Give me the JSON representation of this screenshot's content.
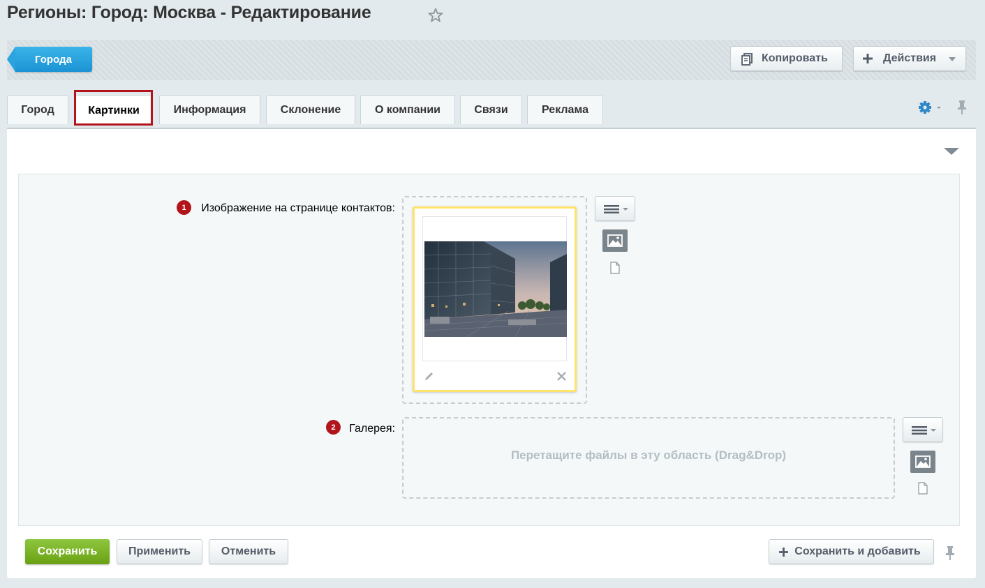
{
  "page": {
    "title": "Регионы: Город: Москва - Редактирование",
    "favorite_icon": "star-icon"
  },
  "toolbar": {
    "back_label": "Города",
    "copy_label": "Копировать",
    "actions_label": "Действия"
  },
  "tabs": [
    {
      "label": "Город",
      "active": false
    },
    {
      "label": "Картинки",
      "active": true
    },
    {
      "label": "Информация",
      "active": false
    },
    {
      "label": "Склонение",
      "active": false
    },
    {
      "label": "О компании",
      "active": false
    },
    {
      "label": "Связи",
      "active": false
    },
    {
      "label": "Реклама",
      "active": false
    }
  ],
  "form": {
    "fields": [
      {
        "badge": "1",
        "label": "Изображение на странице контактов:"
      },
      {
        "badge": "2",
        "label": "Галерея:"
      }
    ],
    "gallery_drop_text": "Перетащите файлы в эту область (Drag&Drop)"
  },
  "footer": {
    "save_label": "Сохранить",
    "apply_label": "Применить",
    "cancel_label": "Отменить",
    "save_add_label": "Сохранить и добавить"
  },
  "colors": {
    "accent_blue": "#1b93d4",
    "save_green": "#6aa113",
    "highlight_red": "#b1141b",
    "preview_border": "#ffe36b"
  }
}
